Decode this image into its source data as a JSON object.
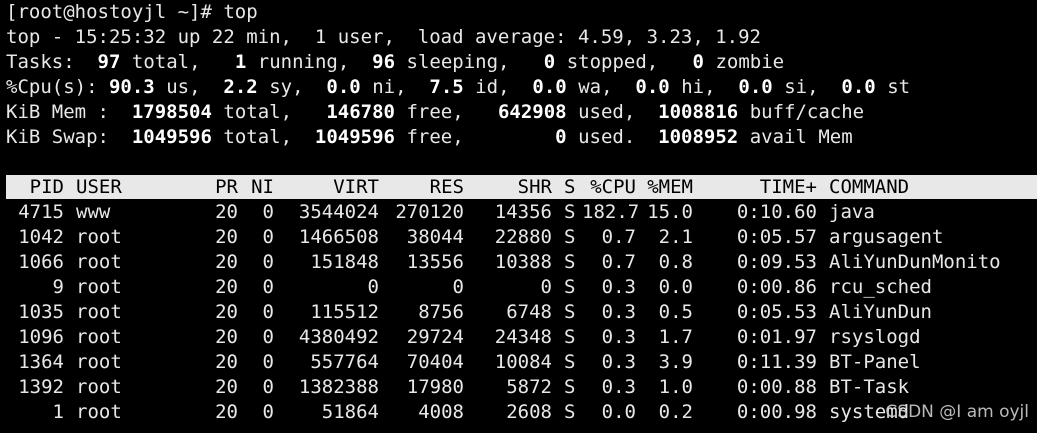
{
  "prompt": "[root@hostoyjl ~]# top",
  "summary": {
    "line1": "top - 15:25:32 up 22 min,  1 user,  load average: 4.59, 3.23, 1.92",
    "tasks": {
      "label": "Tasks:",
      "total": "97",
      "total_label": "total,",
      "running": "1",
      "running_label": "running,",
      "sleeping": "96",
      "sleeping_label": "sleeping,",
      "stopped": "0",
      "stopped_label": "stopped,",
      "zombie": "0",
      "zombie_label": "zombie"
    },
    "cpu": {
      "label": "%Cpu(s):",
      "us": "90.3",
      "us_label": "us,",
      "sy": "2.2",
      "sy_label": "sy,",
      "ni": "0.0",
      "ni_label": "ni,",
      "id": "7.5",
      "id_label": "id,",
      "wa": "0.0",
      "wa_label": "wa,",
      "hi": "0.0",
      "hi_label": "hi,",
      "si": "0.0",
      "si_label": "si,",
      "st": "0.0",
      "st_label": "st"
    },
    "mem": {
      "label": "KiB Mem :",
      "total": "1798504",
      "total_label": "total,",
      "free": "146780",
      "free_label": "free,",
      "used": "642908",
      "used_label": "used,",
      "buff": "1008816",
      "buff_label": "buff/cache"
    },
    "swap": {
      "label": "KiB Swap:",
      "total": "1049596",
      "total_label": "total,",
      "free": "1049596",
      "free_label": "free,",
      "used": "0",
      "used_label": "used.",
      "avail": "1008952",
      "avail_label": "avail Mem"
    }
  },
  "columns": {
    "pid": "PID",
    "user": "USER",
    "pr": "PR",
    "ni": "NI",
    "virt": "VIRT",
    "res": "RES",
    "shr": "SHR",
    "s": "S",
    "cpu": "%CPU",
    "mem": "%MEM",
    "time": "TIME+",
    "command": "COMMAND"
  },
  "processes": [
    {
      "pid": "4715",
      "user": "www",
      "pr": "20",
      "ni": "0",
      "virt": "3544024",
      "res": "270120",
      "shr": "14356",
      "s": "S",
      "cpu": "182.7",
      "mem": "15.0",
      "time": "0:10.60",
      "command": "java"
    },
    {
      "pid": "1042",
      "user": "root",
      "pr": "20",
      "ni": "0",
      "virt": "1466508",
      "res": "38044",
      "shr": "22880",
      "s": "S",
      "cpu": "0.7",
      "mem": "2.1",
      "time": "0:05.57",
      "command": "argusagent"
    },
    {
      "pid": "1066",
      "user": "root",
      "pr": "20",
      "ni": "0",
      "virt": "151848",
      "res": "13556",
      "shr": "10388",
      "s": "S",
      "cpu": "0.7",
      "mem": "0.8",
      "time": "0:09.53",
      "command": "AliYunDunMonito"
    },
    {
      "pid": "9",
      "user": "root",
      "pr": "20",
      "ni": "0",
      "virt": "0",
      "res": "0",
      "shr": "0",
      "s": "S",
      "cpu": "0.3",
      "mem": "0.0",
      "time": "0:00.86",
      "command": "rcu_sched"
    },
    {
      "pid": "1035",
      "user": "root",
      "pr": "20",
      "ni": "0",
      "virt": "115512",
      "res": "8756",
      "shr": "6748",
      "s": "S",
      "cpu": "0.3",
      "mem": "0.5",
      "time": "0:05.53",
      "command": "AliYunDun"
    },
    {
      "pid": "1096",
      "user": "root",
      "pr": "20",
      "ni": "0",
      "virt": "4380492",
      "res": "29724",
      "shr": "24348",
      "s": "S",
      "cpu": "0.3",
      "mem": "1.7",
      "time": "0:01.97",
      "command": "rsyslogd"
    },
    {
      "pid": "1364",
      "user": "root",
      "pr": "20",
      "ni": "0",
      "virt": "557764",
      "res": "70404",
      "shr": "10084",
      "s": "S",
      "cpu": "0.3",
      "mem": "3.9",
      "time": "0:11.39",
      "command": "BT-Panel"
    },
    {
      "pid": "1392",
      "user": "root",
      "pr": "20",
      "ni": "0",
      "virt": "1382388",
      "res": "17980",
      "shr": "5872",
      "s": "S",
      "cpu": "0.3",
      "mem": "1.0",
      "time": "0:00.88",
      "command": "BT-Task"
    },
    {
      "pid": "1",
      "user": "root",
      "pr": "20",
      "ni": "0",
      "virt": "51864",
      "res": "4008",
      "shr": "2608",
      "s": "S",
      "cpu": "0.0",
      "mem": "0.2",
      "time": "0:00.98",
      "command": "systemd"
    }
  ],
  "watermark": "CSDN @I am oyjl"
}
